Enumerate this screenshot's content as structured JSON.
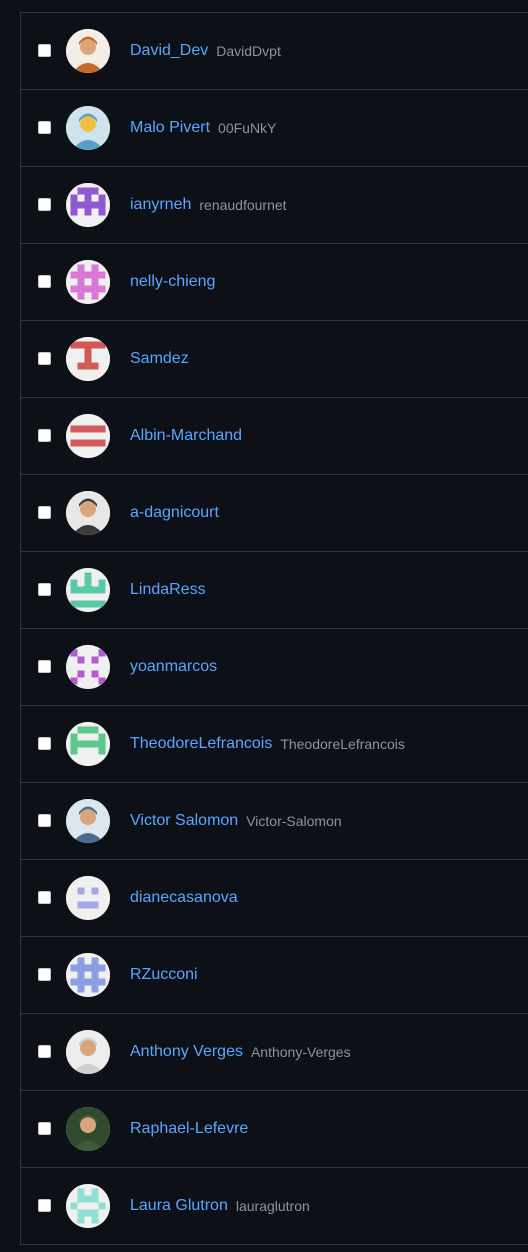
{
  "members": [
    {
      "name": "David_Dev",
      "login": "DavidDvpt",
      "avatar_icon": "photo-avatar-icon",
      "avatar_color": "#c8692a"
    },
    {
      "name": "Malo Pivert",
      "login": "00FuNkY",
      "avatar_icon": "photo-avatar-icon",
      "avatar_color": "#5a9ec8"
    },
    {
      "name": "ianyrneh",
      "login": "renaudfournet",
      "avatar_icon": "identicon-avatar-icon",
      "avatar_color": "#8f5ad0"
    },
    {
      "name": "nelly-chieng",
      "login": "",
      "avatar_icon": "identicon-avatar-icon",
      "avatar_color": "#d979d6"
    },
    {
      "name": "Samdez",
      "login": "",
      "avatar_icon": "identicon-avatar-icon",
      "avatar_color": "#d35a52"
    },
    {
      "name": "Albin-Marchand",
      "login": "",
      "avatar_icon": "identicon-avatar-icon",
      "avatar_color": "#d35a5a"
    },
    {
      "name": "a-dagnicourt",
      "login": "",
      "avatar_icon": "photo-avatar-icon",
      "avatar_color": "#3a3a3a"
    },
    {
      "name": "LindaRess",
      "login": "",
      "avatar_icon": "identicon-avatar-icon",
      "avatar_color": "#5bc9a6"
    },
    {
      "name": "yoanmarcos",
      "login": "",
      "avatar_icon": "identicon-avatar-icon",
      "avatar_color": "#b15ad3"
    },
    {
      "name": "TheodoreLefrancois",
      "login": "TheodoreLefrancois",
      "avatar_icon": "identicon-avatar-icon",
      "avatar_color": "#5bc98c"
    },
    {
      "name": "Victor Salomon",
      "login": "Victor-Salomon",
      "avatar_icon": "photo-avatar-icon",
      "avatar_color": "#4a6a8a"
    },
    {
      "name": "dianecasanova",
      "login": "",
      "avatar_icon": "identicon-avatar-icon",
      "avatar_color": "#a6a6e6"
    },
    {
      "name": "RZucconi",
      "login": "",
      "avatar_icon": "identicon-avatar-icon",
      "avatar_color": "#8b9ee6"
    },
    {
      "name": "Anthony Verges",
      "login": "Anthony-Verges",
      "avatar_icon": "photo-avatar-icon",
      "avatar_color": "#cfcfcf"
    },
    {
      "name": "Raphael-Lefevre",
      "login": "",
      "avatar_icon": "photo-avatar-icon",
      "avatar_color": "#3e5a3a"
    },
    {
      "name": "Laura Glutron",
      "login": "lauraglutron",
      "avatar_icon": "identicon-avatar-icon",
      "avatar_color": "#8ee0d6"
    }
  ]
}
